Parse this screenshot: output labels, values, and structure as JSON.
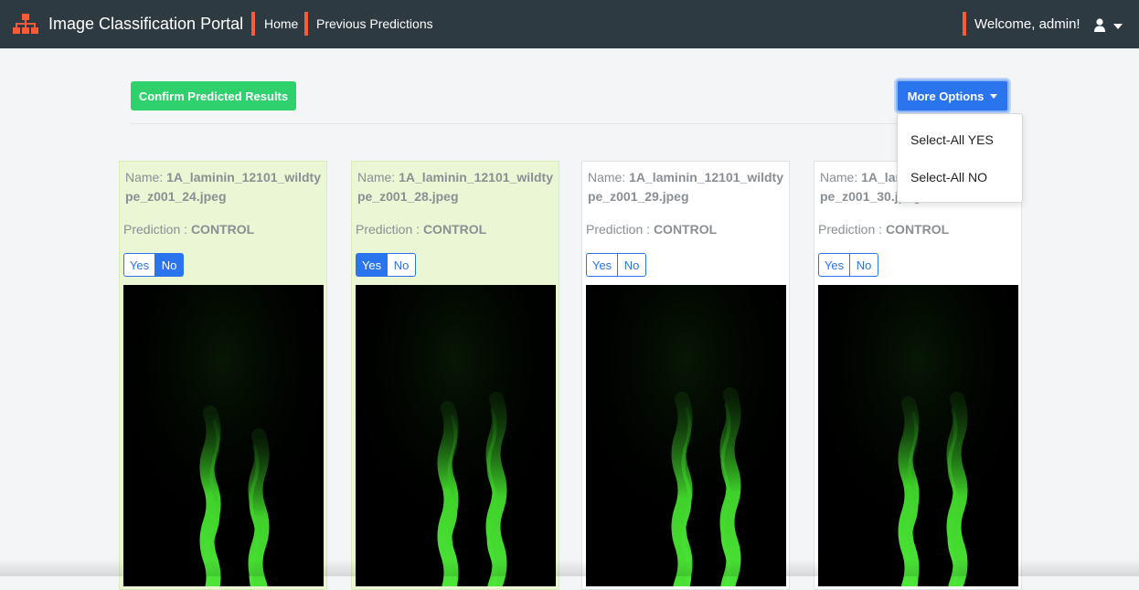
{
  "app": {
    "title": "Image Classification Portal",
    "accent_color": "#ff5a36"
  },
  "nav": {
    "links": [
      {
        "label": "Home"
      },
      {
        "label": "Previous Predictions"
      }
    ],
    "welcome": "Welcome, admin!",
    "user_icon": "user-icon"
  },
  "toolbar": {
    "confirm_label": "Confirm Predicted Results",
    "more_options_label": "More Options"
  },
  "dropdown": {
    "items": [
      {
        "label": "Select-All YES"
      },
      {
        "label": "Select-All NO"
      }
    ]
  },
  "cards": [
    {
      "name_label": "Name: ",
      "name": "1A_laminin_12101_wildtype_z001_24.jpeg",
      "prediction_label": "Prediction : ",
      "prediction": "CONTROL",
      "yes_label": "Yes",
      "no_label": "No",
      "selected": "no",
      "confirmed": true
    },
    {
      "name_label": "Name: ",
      "name": "1A_laminin_12101_wildtype_z001_28.jpeg",
      "prediction_label": "Prediction : ",
      "prediction": "CONTROL",
      "yes_label": "Yes",
      "no_label": "No",
      "selected": "yes",
      "confirmed": true
    },
    {
      "name_label": "Name: ",
      "name": "1A_laminin_12101_wildtype_z001_29.jpeg",
      "prediction_label": "Prediction : ",
      "prediction": "CONTROL",
      "yes_label": "Yes",
      "no_label": "No",
      "selected": "none",
      "confirmed": false
    },
    {
      "name_label": "Name: ",
      "name": "1A_laminin_12101_wildtype_z001_30.jpeg",
      "prediction_label": "Prediction : ",
      "prediction": "CONTROL",
      "yes_label": "Yes",
      "no_label": "No",
      "selected": "none",
      "confirmed": false
    }
  ]
}
